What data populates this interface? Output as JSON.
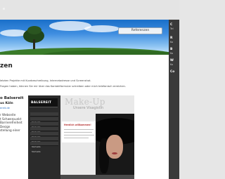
{
  "top": {
    "text": "e"
  },
  "header": {
    "nav_button": "Referenzen"
  },
  "page": {
    "heading": "zen",
    "intro_line1": "letzten Projekte mit Kurzbeschreibung, Internetadresse und Screenshot.",
    "intro_line2": "Fragen haben, können Sie mir über das Kontaktformular schreiben oder mich telefonisch erreichen."
  },
  "client": {
    "title": "o Balsereit",
    "city": "us Köln",
    "link": "ereit.de",
    "features": [
      "r Webseite",
      "t Schwerpunkt",
      "Barrierefreiheit",
      "Design",
      "stellung einer"
    ]
  },
  "preview": {
    "brand": "BALSEREIT",
    "menu": [
      "Startseite",
      "Startseite",
      "Startseite",
      "Startseite",
      "Startseite",
      "Startseite",
      "Startseite"
    ],
    "makeup_title": "Make-Up",
    "subtitle": "Unsere Visagistin",
    "welcome": "Herzlich willkommen!"
  },
  "sidebar": {
    "items": [
      {
        "label": "C",
        "top": "Tel",
        "sub": ""
      },
      {
        "label": "R",
        "sub": "Ko"
      },
      {
        "label": "B",
        "sub": "Ko"
      },
      {
        "label": "W",
        "sub": "Ko"
      },
      {
        "label": "Co",
        "sub": ""
      }
    ]
  },
  "colors": {
    "banner_sky": "#3f8ee0",
    "link": "#2a6fc4",
    "sidebar_bg": "#3a3a3a",
    "preview_side": "#2b2b2b"
  }
}
